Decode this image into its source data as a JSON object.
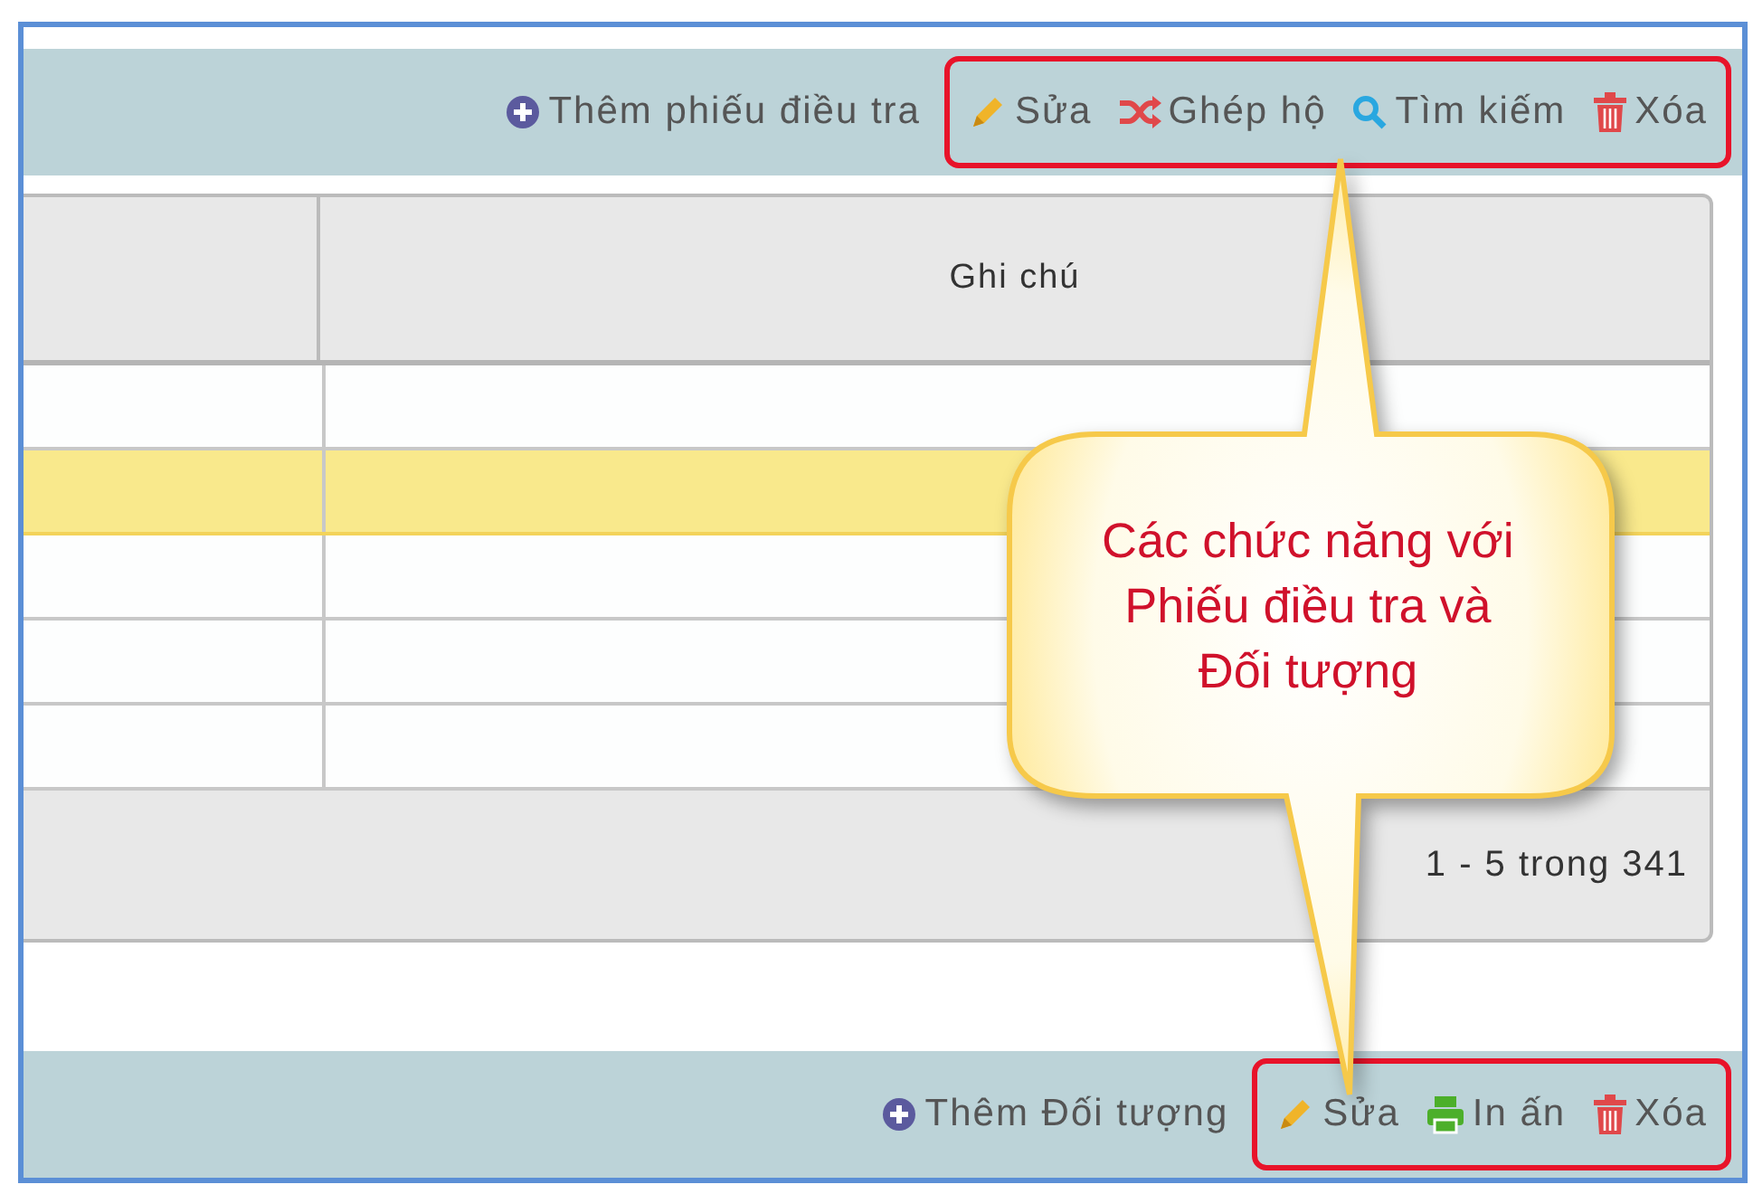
{
  "top_toolbar": {
    "groups": [
      {
        "highlighted": false,
        "actions": [
          {
            "kind": "add",
            "label": "Thêm phiếu điều tra"
          }
        ]
      },
      {
        "highlighted": true,
        "actions": [
          {
            "kind": "edit",
            "label": "Sửa"
          },
          {
            "kind": "merge",
            "label": "Ghép hộ"
          },
          {
            "kind": "search",
            "label": "Tìm kiếm"
          },
          {
            "kind": "delete",
            "label": "Xóa"
          }
        ]
      }
    ]
  },
  "table": {
    "column_headers": [
      "Ghi chú"
    ],
    "rows": [
      {
        "selected": false
      },
      {
        "selected": true
      },
      {
        "selected": false
      },
      {
        "selected": false
      },
      {
        "selected": false
      }
    ],
    "pagination": "1 - 5 trong 341"
  },
  "callout": {
    "lines": [
      "Các chức năng với",
      "Phiếu điều tra và",
      "Đối tượng"
    ]
  },
  "bottom_toolbar": {
    "groups": [
      {
        "highlighted": false,
        "actions": [
          {
            "kind": "add",
            "label": "Thêm Đối tượng"
          }
        ]
      },
      {
        "highlighted": true,
        "actions": [
          {
            "kind": "edit",
            "label": "Sửa"
          },
          {
            "kind": "print",
            "label": "In ấn"
          },
          {
            "kind": "delete",
            "label": "Xóa"
          }
        ]
      }
    ]
  }
}
